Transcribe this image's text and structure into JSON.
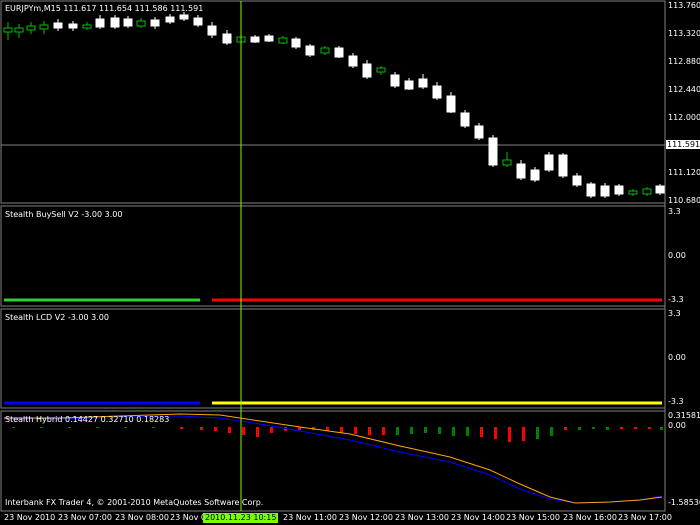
{
  "colors": {
    "background": "#000000",
    "bull_candle": "#ffffff",
    "bear_candle": "#000000",
    "small_candle": "#00c000",
    "crosshair": "#7cfc00",
    "buysell_up": "#32cd32",
    "buysell_down": "#ff0000",
    "lcd_down": "#0000ff",
    "lcd_up": "#ffff00",
    "hybrid_pos": "#008000",
    "hybrid_neg": "#ff0000",
    "hybrid_line_fast": "#ffa500",
    "hybrid_line_slow": "#0000ff"
  },
  "main": {
    "title": "EURJPYm,M15  111.617 111.654 111.586 111.591",
    "price_axis": [
      "113.760",
      "113.320",
      "112.880",
      "112.440",
      "112.000",
      "111.591",
      "111.120",
      "110.680"
    ],
    "current_price": "111.591"
  },
  "buysell": {
    "title": "Stealth BuySell V2 -3.00 3.00",
    "axis": [
      "3.3",
      "0.00",
      "-3.3"
    ]
  },
  "lcd": {
    "title": "Stealth LCD V2 -3.00 3.00",
    "axis": [
      "3.3",
      "0.00",
      "-3.3"
    ]
  },
  "hybrid": {
    "title": "Stealth Hybrid 0.14427 0.32710 0.18283",
    "axis_top": "0.31581",
    "axis_zero": "0.00",
    "axis_bottom": "-1.58536",
    "copyright": "Interbank FX Trader 4, © 2001-2010 MetaQuotes Software Corp."
  },
  "time_axis": {
    "labels": [
      "23 Nov 2010",
      "23 Nov 07:00",
      "23 Nov 08:00",
      "23 Nov 09:00",
      "23 Nov 11:00",
      "23 Nov 12:00",
      "23 Nov 13:00",
      "23 Nov 14:00",
      "23 Nov 15:00",
      "23 Nov 16:00",
      "23 Nov 17:00"
    ],
    "cursor_label": "2010.11.23 10:15"
  }
}
